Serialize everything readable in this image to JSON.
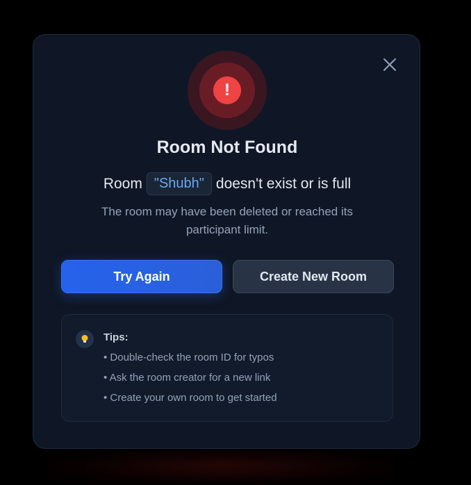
{
  "modal": {
    "title": "Room Not Found",
    "room_prefix": "Room",
    "room_name": "\"Shubh\"",
    "room_suffix": "doesn't exist or is full",
    "description": "The room may have been deleted or reached its participant limit.",
    "alert_symbol": "!",
    "icons": {
      "close": "close-icon",
      "alert": "alert-icon",
      "tips": "lightbulb-icon"
    },
    "colors": {
      "accent": "#2563eb",
      "danger": "#ef4444",
      "room_name": "#6aa8f5"
    }
  },
  "buttons": {
    "try_again": "Try Again",
    "create_new_room": "Create New Room"
  },
  "tips": {
    "title": "Tips:",
    "items": [
      "• Double-check the room ID for typos",
      "• Ask the room creator for a new link",
      "• Create your own room to get started"
    ]
  }
}
